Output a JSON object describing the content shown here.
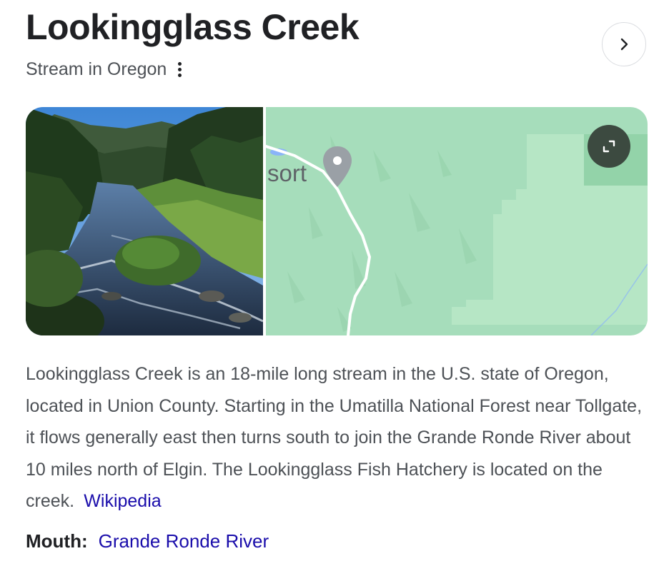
{
  "header": {
    "title": "Lookingglass Creek",
    "subtitle": "Stream in Oregon",
    "more_options_icon": "more-vert-icon",
    "next_icon": "chevron-right-icon"
  },
  "media": {
    "photo_description_icon": "river-photo",
    "map": {
      "place_label_fragment": "sort",
      "pin_icon": "map-pin-icon",
      "expand_icon": "expand-icon",
      "colors": {
        "land": "#a6ddbb",
        "forest_light": "#b6e6c5",
        "forest_dark": "#8fd0a6",
        "road": "#ffffff",
        "pin": "#9aa0a6"
      }
    }
  },
  "description": {
    "text": "Lookingglass Creek is an 18-mile long stream in the U.S. state of Oregon, located in Union County. Starting in the Umatilla National Forest near Tollgate, it flows generally east then turns south to join the Grande Ronde River about 10 miles north of Elgin. The Lookingglass Fish Hatchery is located on the creek.",
    "source_link": "Wikipedia"
  },
  "facts": [
    {
      "label": "Mouth:",
      "value": "Grande Ronde River"
    }
  ],
  "colors": {
    "link": "#1a0dab",
    "text": "#202124",
    "secondary_text": "#4d5156",
    "expand_button_bg": "#3c4a40"
  }
}
